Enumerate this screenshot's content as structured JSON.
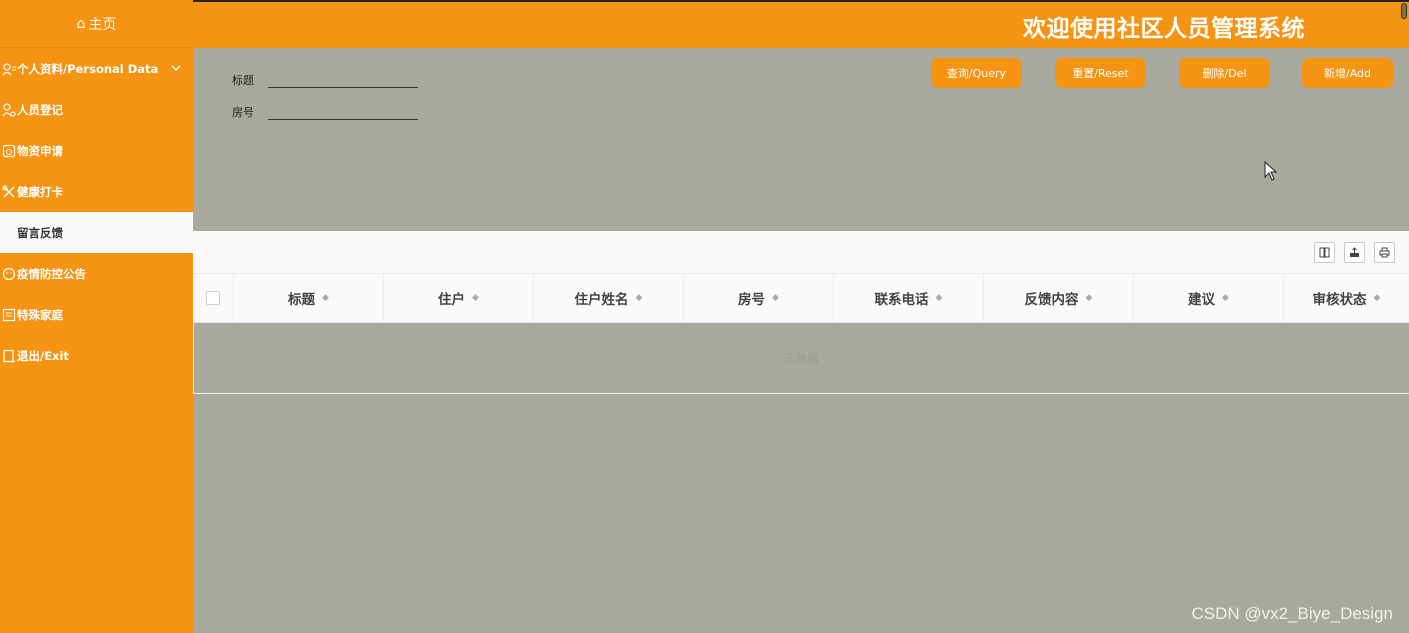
{
  "sidebar": {
    "home_icon": "home-icon",
    "home_label": "主页",
    "items": [
      {
        "label": "个人资料/Personal Data",
        "icon": "user-card-icon",
        "expandable": true
      },
      {
        "label": "人员登记",
        "icon": "person-icon"
      },
      {
        "label": "物资申请",
        "icon": "box-icon"
      },
      {
        "label": "健康打卡",
        "icon": "health-icon"
      },
      {
        "label": "留言反馈",
        "icon": "",
        "active": true
      },
      {
        "label": "疫情防控公告",
        "icon": "notice-icon"
      },
      {
        "label": "特殊家庭",
        "icon": "list-icon"
      },
      {
        "label": "退出/Exit",
        "icon": "exit-icon"
      }
    ]
  },
  "header": {
    "title": "欢迎使用社区人员管理系统"
  },
  "search": {
    "fields": [
      {
        "label": "标题",
        "value": "",
        "placeholder": ""
      },
      {
        "label": "房号",
        "value": "",
        "placeholder": ""
      }
    ]
  },
  "actions": {
    "query": "查询/Query",
    "reset": "重置/Reset",
    "delete": "删除/Del",
    "add": "新增/Add"
  },
  "table": {
    "toolbar_icons": [
      "columns-icon",
      "export-icon",
      "print-icon"
    ],
    "columns": [
      "标题",
      "住户",
      "住户姓名",
      "房号",
      "联系电话",
      "反馈内容",
      "建议",
      "审核状态"
    ],
    "rows": [],
    "empty_text": "无数据"
  },
  "watermark": "CSDN @vx2_Biye_Design",
  "colors": {
    "accent": "#f59313",
    "background": "#a8a99c",
    "panel": "#fafafa"
  }
}
